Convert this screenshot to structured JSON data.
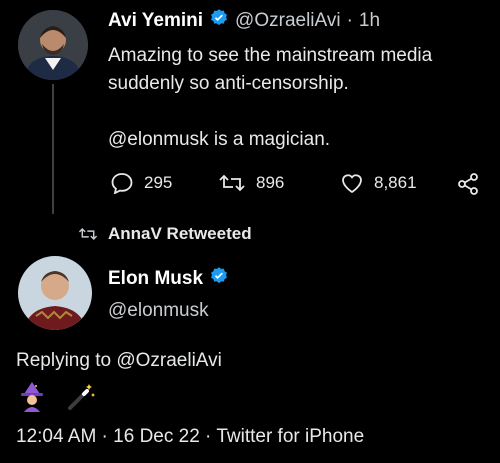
{
  "tweet1": {
    "name": "Avi Yemini",
    "handle": "@OzraeliAvi",
    "dot": "·",
    "time": "1h",
    "text_line1": "Amazing to see the mainstream media",
    "text_line2": "suddenly so anti-censorship.",
    "text_line3": "@elonmusk is a magician.",
    "replies": "295",
    "retweets": "896",
    "likes": "8,861"
  },
  "retweet_banner": {
    "label": "AnnaV Retweeted"
  },
  "tweet2": {
    "name": "Elon Musk",
    "handle": "@elonmusk",
    "replying_to": "Replying to @OzraeliAvi",
    "meta": "12:04 AM · 16 Dec 22 · Twitter for iPhone"
  },
  "colors": {
    "background": "#000000",
    "text": "#e7e9ea",
    "verified": "#1d9bf0",
    "thread_line": "#3e4144"
  },
  "icons": [
    "verified-badge-icon",
    "reply-icon",
    "retweet-icon",
    "like-icon",
    "share-icon",
    "retweeted-icon",
    "wizard-emoji-icon",
    "magic-wand-emoji-icon"
  ]
}
